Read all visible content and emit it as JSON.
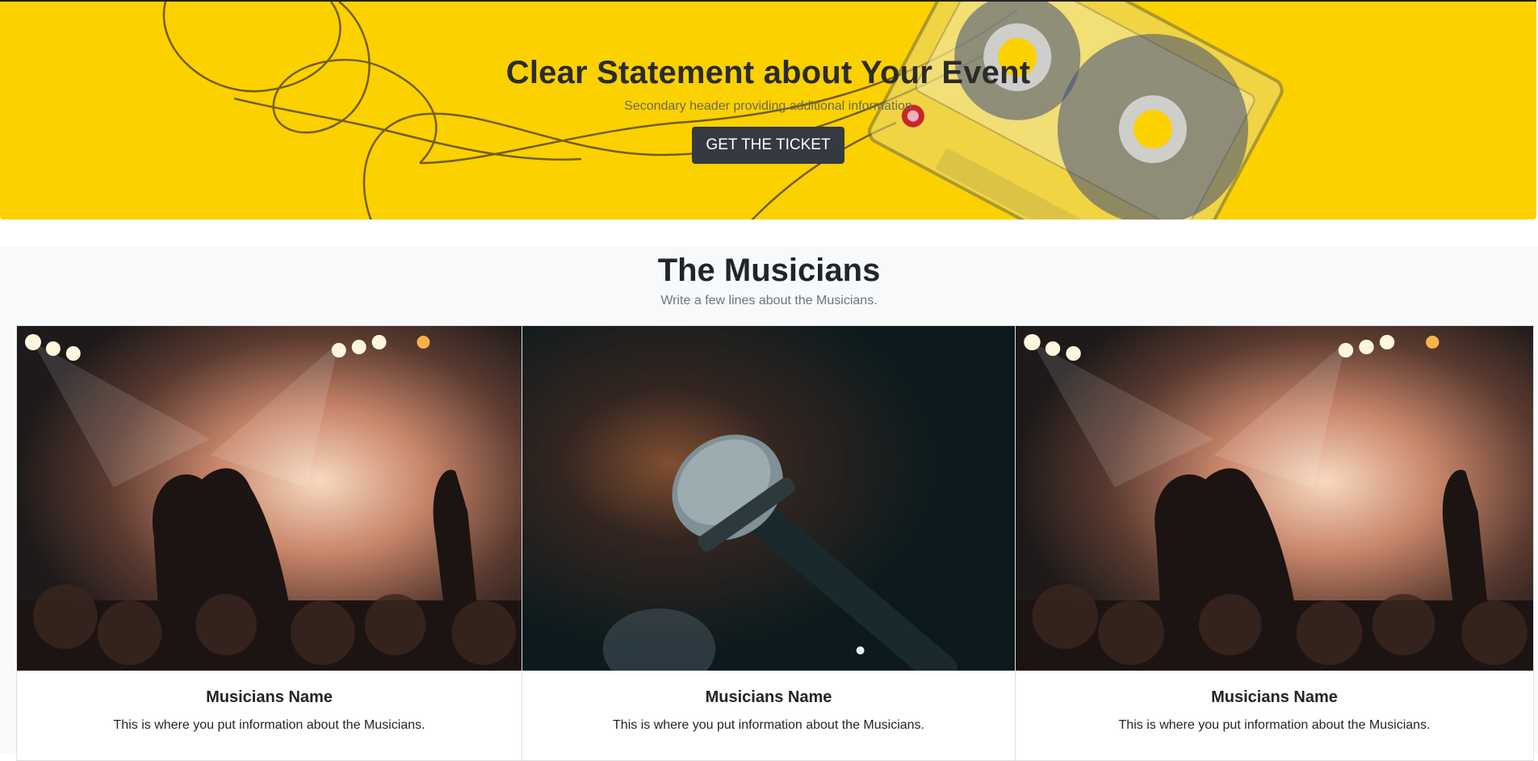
{
  "hero": {
    "title": "Clear Statement about Your Event",
    "subtitle": "Secondary header providing additional information",
    "cta_label": "GET THE TICKET",
    "background_color": "#fcd100",
    "image": "yellow-background-with-cassette-tape"
  },
  "musicians": {
    "title": "The Musicians",
    "subtitle": "Write a few lines about the Musicians.",
    "cards": [
      {
        "image": "concert-crowd-heart-hands-photo",
        "name": "Musicians Name",
        "text": "This is where you put information about the Musicians."
      },
      {
        "image": "microphone-on-stage-photo",
        "name": "Musicians Name",
        "text": "This is where you put information about the Musicians."
      },
      {
        "image": "concert-crowd-heart-hands-photo",
        "name": "Musicians Name",
        "text": "This is where you put information about the Musicians."
      }
    ]
  },
  "colors": {
    "button_dark": "#343a40",
    "section_bg": "#f8f9fa",
    "muted_text": "#6c757d"
  }
}
